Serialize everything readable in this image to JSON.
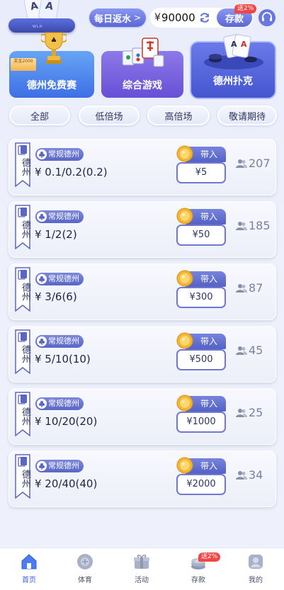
{
  "header": {
    "rebate_label": "每日返水",
    "rebate_chevron": ">",
    "currency": "¥",
    "balance": "90000",
    "deposit_label": "存款",
    "deposit_badge": "送2%"
  },
  "categories": [
    {
      "label": "德州免费赛",
      "tag": "奖金2000"
    },
    {
      "label": "综合游戏"
    },
    {
      "label": "德州扑克"
    }
  ],
  "filters": [
    "全部",
    "低倍场",
    "高倍场",
    "敬请期待"
  ],
  "rooms": [
    {
      "flag": "德州",
      "type": "常规德州",
      "stakes": "¥ 0.1/0.2(0.2)",
      "buyin_label": "带入",
      "buyin": "¥5",
      "players": "207"
    },
    {
      "flag": "德州",
      "type": "常规德州",
      "stakes": "¥ 1/2(2)",
      "buyin_label": "带入",
      "buyin": "¥50",
      "players": "185"
    },
    {
      "flag": "德州",
      "type": "常规德州",
      "stakes": "¥ 3/6(6)",
      "buyin_label": "带入",
      "buyin": "¥300",
      "players": "87"
    },
    {
      "flag": "德州",
      "type": "常规德州",
      "stakes": "¥ 5/10(10)",
      "buyin_label": "带入",
      "buyin": "¥500",
      "players": "45"
    },
    {
      "flag": "德州",
      "type": "常规德州",
      "stakes": "¥ 10/20(20)",
      "buyin_label": "带入",
      "buyin": "¥1000",
      "players": "25"
    },
    {
      "flag": "德州",
      "type": "常规德州",
      "stakes": "¥ 20/40(40)",
      "buyin_label": "带入",
      "buyin": "¥2000",
      "players": "34"
    }
  ],
  "bottom_nav": [
    {
      "label": "首页",
      "icon": "home-icon",
      "active": true
    },
    {
      "label": "体育",
      "icon": "sports-ball-icon"
    },
    {
      "label": "活动",
      "icon": "gift-icon"
    },
    {
      "label": "存款",
      "icon": "deposit-coins-icon",
      "badge": "送2%"
    },
    {
      "label": "我的",
      "icon": "profile-icon"
    }
  ],
  "colors": {
    "accent": "#5b68d8",
    "badge_red": "#f04646",
    "nav_active": "#3c5fe0"
  }
}
